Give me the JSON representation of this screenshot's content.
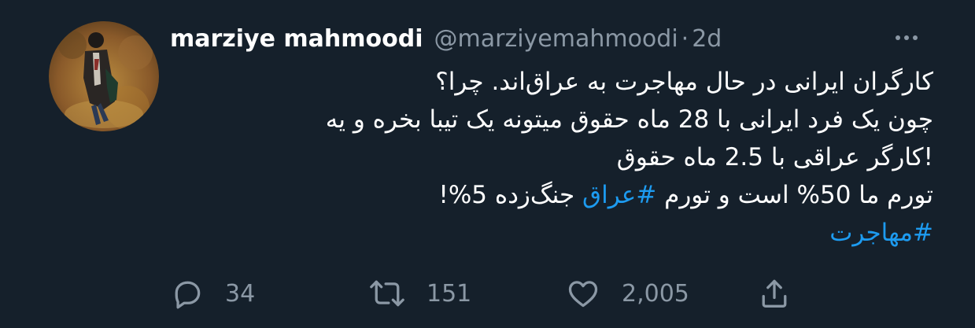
{
  "tweet": {
    "display_name": "marziye mahmoodi",
    "handle": "@marziyemahmoodi",
    "separator": "·",
    "time": "2d",
    "body_lines": [
      "کارگران ایرانی در حال مهاجرت به عراق‌اند. چرا؟",
      "چون یک فرد ایرانی با 28 ماه حقوق میتونه یک تیبا بخره و یه",
      "!کارگر عراقی با 2.5 ماه حقوق",
      {
        "before": "تورم ما 50% است و تورم ",
        "hashtag": "#عراق",
        "after": " جنگ‌زده 5%!"
      }
    ],
    "hashtag_line": "#مهاجرت"
  },
  "actions": {
    "reply": {
      "icon": "reply-icon",
      "count": "34"
    },
    "retweet": {
      "icon": "retweet-icon",
      "count": "151"
    },
    "like": {
      "icon": "heart-icon",
      "count": "2,005"
    },
    "share": {
      "icon": "share-icon"
    }
  },
  "colors": {
    "background": "#15202b",
    "text": "#ffffff",
    "muted": "#8b98a5",
    "accent": "#1d9bf0"
  }
}
